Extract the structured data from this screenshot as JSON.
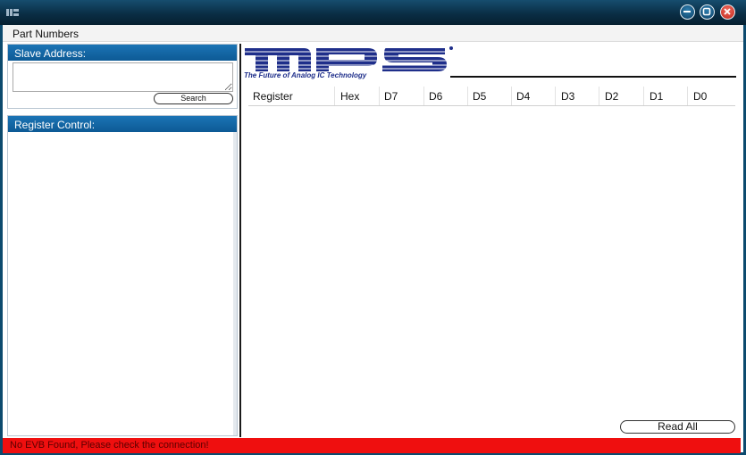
{
  "window": {
    "app_icon": "mps-app-icon",
    "controls": [
      "minimize-icon",
      "maximize-icon",
      "close-icon"
    ]
  },
  "menu": {
    "items": [
      {
        "label": "Part Numbers"
      }
    ]
  },
  "slave": {
    "header": "Slave Address:",
    "input_value": "",
    "search_label": "Search"
  },
  "register_control": {
    "header": "Register Control:"
  },
  "logo": {
    "brand": "MPS",
    "tagline": "The Future of Analog IC Technology"
  },
  "table": {
    "columns": [
      "Register",
      "Hex",
      "D7",
      "D6",
      "D5",
      "D4",
      "D3",
      "D2",
      "D1",
      "D0"
    ]
  },
  "actions": {
    "read_all_label": "Read All"
  },
  "status": {
    "text": "No EVB Found, Please check the connection!"
  },
  "colors": {
    "titlebar": "#0a2e45",
    "panel_header": "#1b74b5",
    "status_error": "#ef0f0f",
    "logo_blue": "#1e2e8a"
  }
}
